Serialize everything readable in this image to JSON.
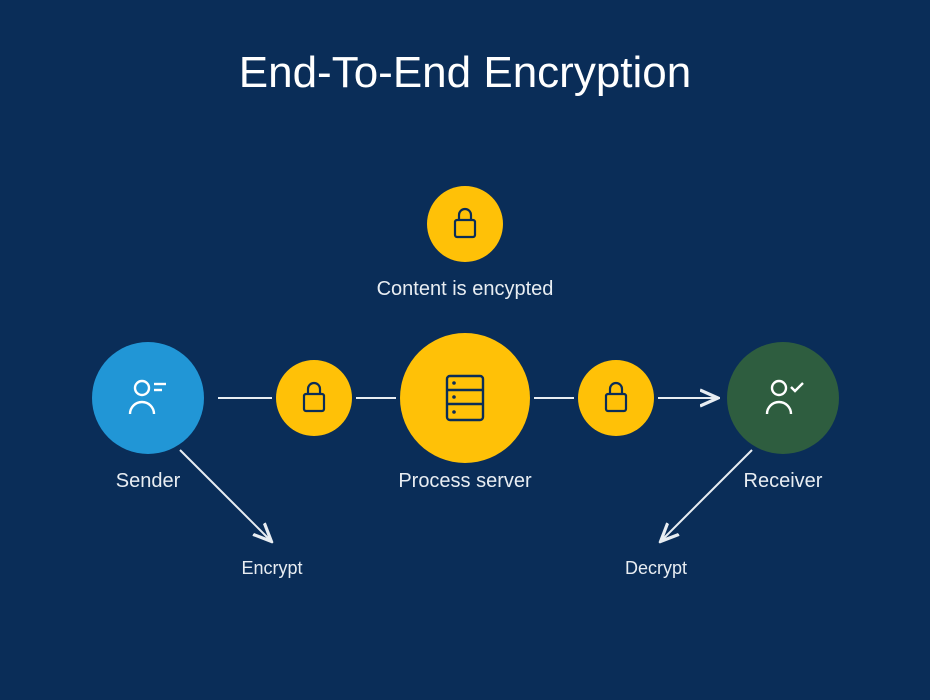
{
  "title": "End-To-End Encryption",
  "labels": {
    "content_encrypted": "Content is encypted",
    "sender": "Sender",
    "process_server": "Process server",
    "receiver": "Receiver",
    "encrypt": "Encrypt",
    "decrypt": "Decrypt"
  },
  "icons": {
    "top_lock": "lock-icon",
    "sender": "user-sender-icon",
    "lock_left": "lock-icon",
    "server": "server-icon",
    "lock_right": "lock-icon",
    "receiver": "user-receiver-icon"
  },
  "colors": {
    "background": "#0a2d58",
    "yellow": "#ffc107",
    "blue": "#2196d6",
    "green": "#2e5d3f",
    "text": "#e8edf2",
    "icon_dark": "#0a2d58",
    "icon_light": "#ffffff"
  }
}
